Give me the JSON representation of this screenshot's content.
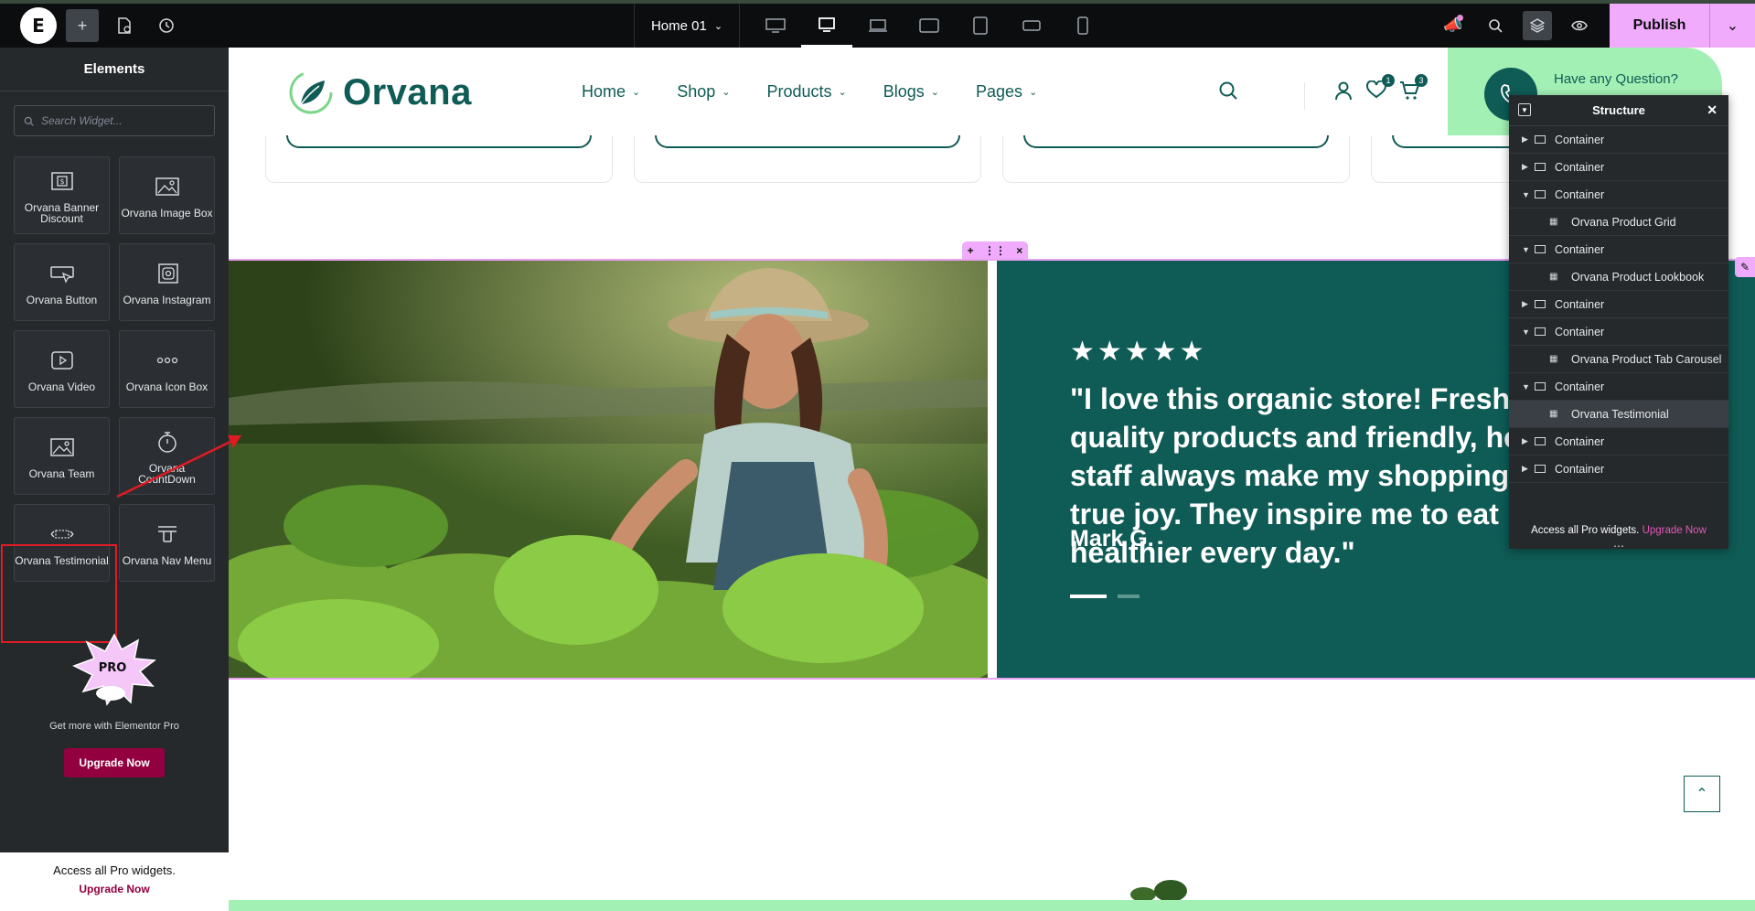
{
  "topbar": {
    "logo_letter": "E",
    "document": {
      "label": "Home 01"
    },
    "devices": [
      "desktop",
      "tablet-landscape",
      "laptop",
      "tablet",
      "tablet-portrait",
      "mobile-landscape",
      "mobile"
    ],
    "active_device": 1,
    "publish_label": "Publish"
  },
  "panel": {
    "title": "Elements",
    "search_placeholder": "Search Widget...",
    "widgets": [
      {
        "label": "Orvana Banner Discount",
        "icon": "banner-icon"
      },
      {
        "label": "Orvana Image Box",
        "icon": "image-box-icon"
      },
      {
        "label": "Orvana Button",
        "icon": "button-icon"
      },
      {
        "label": "Orvana Instagram",
        "icon": "instagram-icon"
      },
      {
        "label": "Orvana Video",
        "icon": "video-icon"
      },
      {
        "label": "Orvana Icon Box",
        "icon": "icon-box-icon"
      },
      {
        "label": "Orvana Team",
        "icon": "team-icon"
      },
      {
        "label": "Orvana CountDown",
        "icon": "countdown-icon"
      },
      {
        "label": "Orvana Testimonial",
        "icon": "testimonial-icon"
      },
      {
        "label": "Orvana Nav Menu",
        "icon": "nav-menu-icon"
      }
    ],
    "pro_text": "Get more with Elementor Pro",
    "upgrade_label": "Upgrade Now",
    "footer_text": "Access all Pro widgets.",
    "footer_link": "Upgrade Now"
  },
  "site": {
    "logo_text": "Orvana",
    "nav": [
      "Home",
      "Shop",
      "Products",
      "Blogs",
      "Pages"
    ],
    "wishlist_count": "1",
    "cart_count": "3",
    "question_text": "Have any Question?",
    "accent": "#0f5b55",
    "mint": "#a3f0b5"
  },
  "testimonial": {
    "stars": "★★★★★",
    "quote": "\"I love this organic store! Fresh, quality products and friendly, helpful staff always make my shopping a true joy. They inspire me to eat healthier every day.\"",
    "author": "Mark G."
  },
  "structure": {
    "title": "Structure",
    "rows": [
      {
        "label": "Container",
        "child": false,
        "open": false
      },
      {
        "label": "Container",
        "child": false,
        "open": false
      },
      {
        "label": "Container",
        "child": false,
        "open": true
      },
      {
        "label": "Orvana Product Grid",
        "child": true
      },
      {
        "label": "Container",
        "child": false,
        "open": true
      },
      {
        "label": "Orvana Product Lookbook",
        "child": true
      },
      {
        "label": "Container",
        "child": false,
        "open": false
      },
      {
        "label": "Container",
        "child": false,
        "open": true
      },
      {
        "label": "Orvana Product Tab Carousel",
        "child": true
      },
      {
        "label": "Container",
        "child": false,
        "open": true
      },
      {
        "label": "Orvana Testimonial",
        "child": true,
        "selected": true
      },
      {
        "label": "Container",
        "child": false,
        "open": false
      },
      {
        "label": "Container",
        "child": false,
        "open": false
      }
    ],
    "footer_text": "Access all Pro widgets.",
    "footer_link": "Upgrade Now"
  }
}
